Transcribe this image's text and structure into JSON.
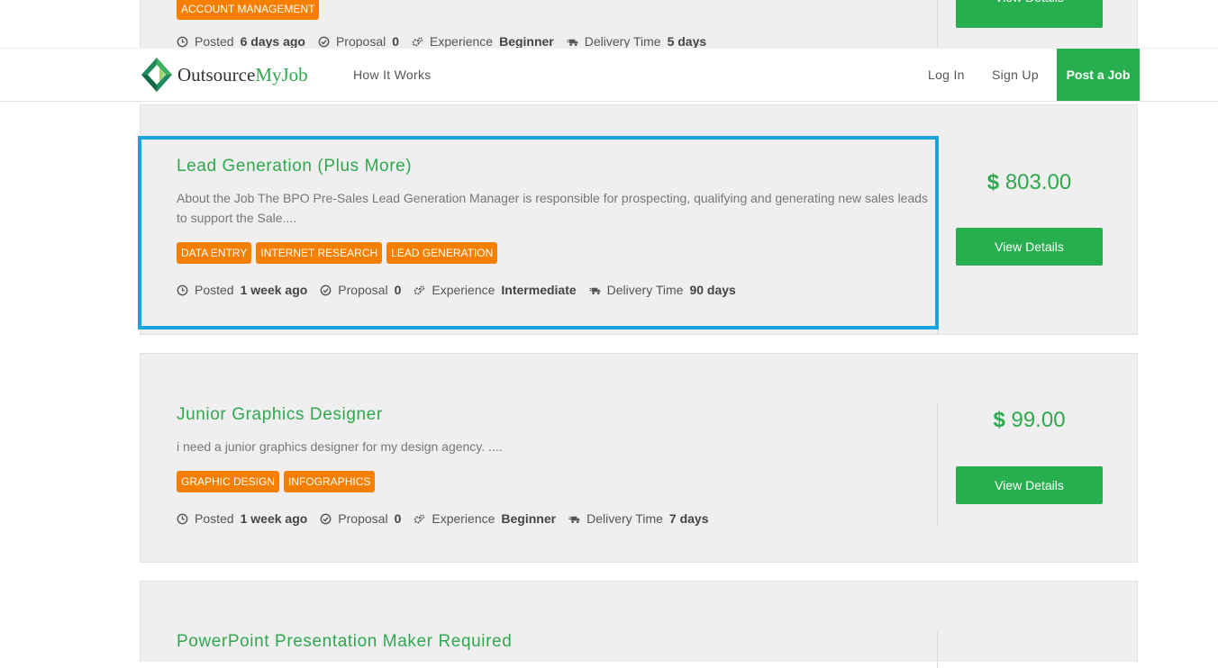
{
  "header": {
    "logo_part1": "Outsource",
    "logo_part2": "MyJob",
    "how_it_works": "How It Works",
    "log_in": "Log In",
    "sign_up": "Sign Up",
    "post_job": "Post a Job"
  },
  "meta_labels": {
    "posted": "Posted",
    "proposal": "Proposal",
    "experience": "Experience",
    "delivery": "Delivery Time"
  },
  "currency": "$",
  "view_details": "View Details",
  "jobs": [
    {
      "tags": [
        "ACCOUNT MANAGEMENT"
      ],
      "posted": "6 days ago",
      "proposal": "0",
      "experience": "Beginner",
      "delivery": "5 days"
    },
    {
      "title": "Lead Generation (Plus More)",
      "description": "About the Job The BPO Pre-Sales Lead Generation Manager is responsible for prospecting, qualifying and generating new sales leads to support the Sale....",
      "tags": [
        "DATA ENTRY",
        "INTERNET RESEARCH",
        "LEAD GENERATION"
      ],
      "posted": "1 week ago",
      "proposal": "0",
      "experience": "Intermediate",
      "delivery": "90 days",
      "price": "803.00"
    },
    {
      "title": "Junior Graphics Designer",
      "description": "i need a junior graphics designer for my design agency. ....",
      "tags": [
        "GRAPHIC DESIGN",
        "INFOGRAPHICS"
      ],
      "posted": "1 week ago",
      "proposal": "0",
      "experience": "Beginner",
      "delivery": "7 days",
      "price": "99.00"
    },
    {
      "title": "PowerPoint Presentation Maker Required"
    }
  ],
  "icons": {
    "posted": "clock-icon",
    "proposal": "check-circle-icon",
    "experience": "gears-icon",
    "delivery": "truck-icon"
  },
  "colors": {
    "brand_green": "#27ae4e",
    "title_green": "#2fa84f",
    "tag_orange": "#f77f00",
    "highlight_blue": "#1aa3df"
  }
}
